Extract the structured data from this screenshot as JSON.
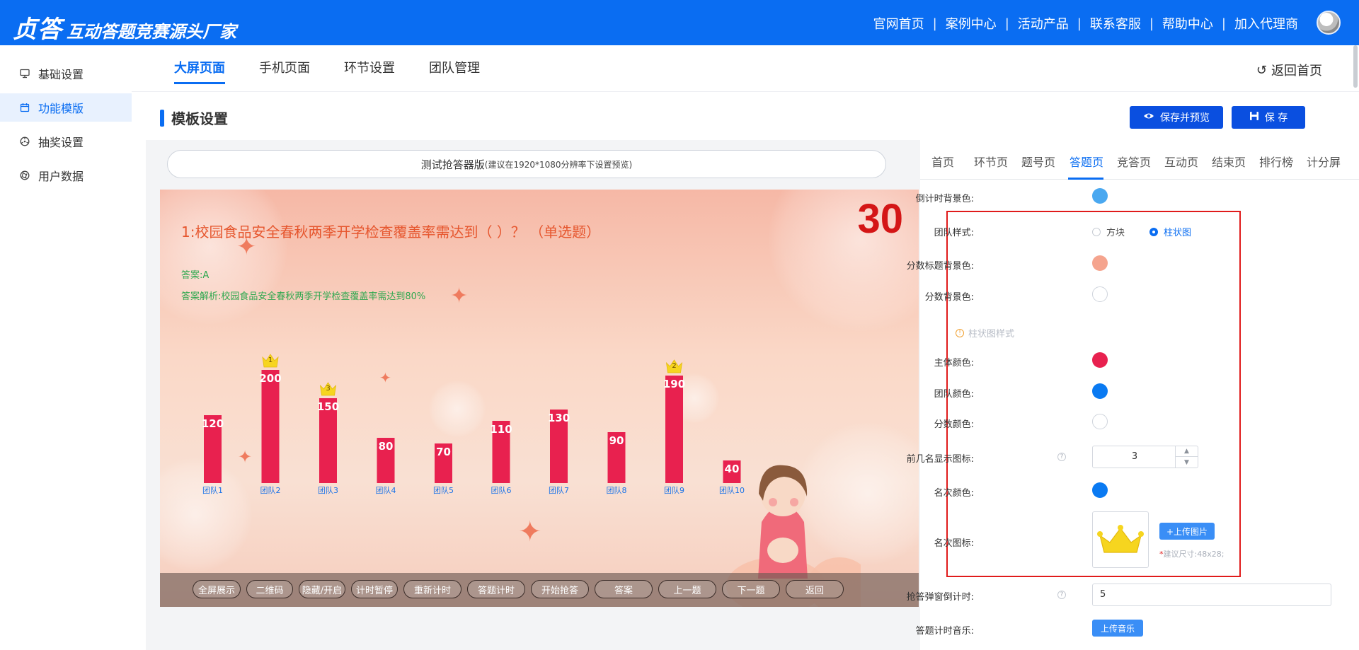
{
  "header": {
    "logo": "贞答",
    "slogan": "互动答题竞赛源头厂家",
    "nav": [
      "官网首页",
      "案例中心",
      "活动产品",
      "联系客服",
      "帮助中心",
      "加入代理商"
    ]
  },
  "sidebar": {
    "items": [
      {
        "label": "基础设置",
        "icon": "monitor-icon",
        "active": false
      },
      {
        "label": "功能模版",
        "icon": "calendar-icon",
        "active": true
      },
      {
        "label": "抽奖设置",
        "icon": "wheel-icon",
        "active": false
      },
      {
        "label": "用户数据",
        "icon": "aperture-icon",
        "active": false
      }
    ]
  },
  "main": {
    "tabs": [
      "大屏页面",
      "手机页面",
      "环节设置",
      "团队管理"
    ],
    "active_tab": "大屏页面",
    "back_home": "返回首页",
    "section_title": "模板设置",
    "save_preview": "保存并预览",
    "save": "保 存"
  },
  "preview": {
    "title": "测试抢答器版",
    "title_note": "(建议在1920*1080分辨率下设置预览)",
    "question": "1:校园食品安全春秋两季开学检查覆盖率需达到（ ）？ （单选题）",
    "timer": "30",
    "answer": "答案:A",
    "analysis": "答案解析:校园食品安全春秋两季开学检查覆盖率需达到80%",
    "controls": [
      "全屏展示",
      "二维码",
      "隐藏/开启",
      "计时暂停",
      "重新计时",
      "答题计时",
      "开始抢答",
      "答案",
      "上一题",
      "下一题",
      "返回"
    ]
  },
  "chart_data": {
    "type": "bar",
    "categories": [
      "团队1",
      "团队2",
      "团队3",
      "团队4",
      "团队5",
      "团队6",
      "团队7",
      "团队8",
      "团队9",
      "团队10"
    ],
    "values": [
      120,
      200,
      150,
      80,
      70,
      110,
      130,
      90,
      190,
      40
    ],
    "rank_crowns": [
      {
        "team": "团队2",
        "rank": 1
      },
      {
        "team": "团队9",
        "rank": 2
      },
      {
        "team": "团队3",
        "rank": 3
      }
    ],
    "bar_color": "#e8214f",
    "label_color": "#1a73e8",
    "value_color": "#ffffff",
    "ylim": [
      0,
      200
    ]
  },
  "settings": {
    "tabs": [
      "首页",
      "环节页",
      "题号页",
      "答题页",
      "竞答页",
      "互动页",
      "结束页",
      "排行榜",
      "计分屏"
    ],
    "active_tab": "答题页",
    "countdown_bg_label": "倒计时背景色:",
    "countdown_bg_color": "#4aa8f0",
    "team_style_label": "团队样式:",
    "team_style_options": [
      "方块",
      "柱状图"
    ],
    "team_style_selected": "柱状图",
    "score_title_bg_label": "分数标题背景色:",
    "score_title_bg_color": "#f5a48e",
    "score_bg_label": "分数背景色:",
    "score_bg_color": "#ffffff",
    "bar_style_title": "柱状图样式",
    "main_color_label": "主体颜色:",
    "main_color": "#e8214f",
    "team_color_label": "团队颜色:",
    "team_color": "#0a7af2",
    "score_color_label": "分数颜色:",
    "score_color": "#ffffff",
    "top_n_label": "前几名显示图标:",
    "top_n_value": "3",
    "rank_color_label": "名次颜色:",
    "rank_color": "#0a7af2",
    "rank_icon_label": "名次图标:",
    "upload_image": "+上传图片",
    "size_hint_star": "*",
    "size_hint": "建议尺寸:48x28;",
    "buzz_countdown_label": "抢答弹窗倒计时:",
    "buzz_countdown_value": "5",
    "answer_music_label": "答题计时音乐:",
    "upload_music": "上传音乐"
  }
}
